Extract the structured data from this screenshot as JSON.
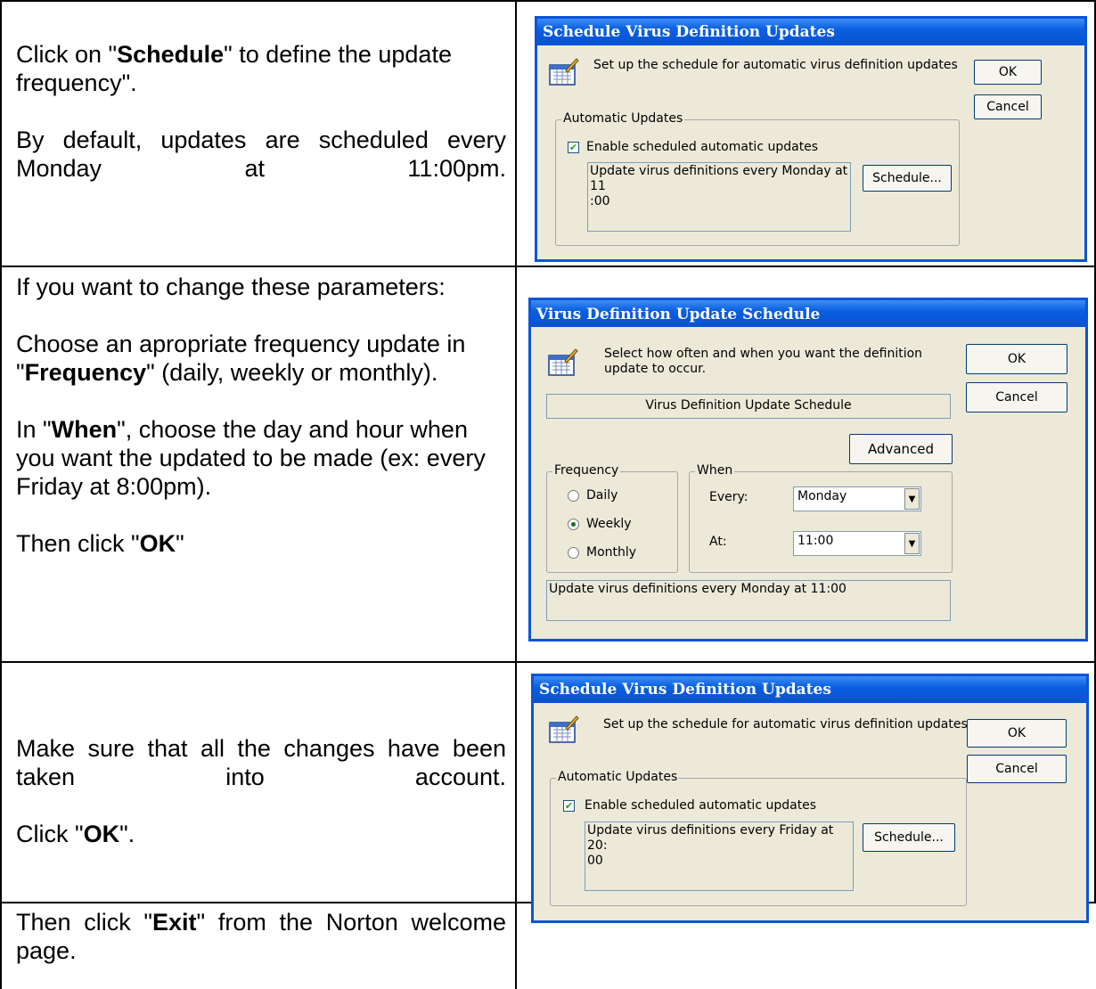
{
  "rows": [
    {
      "left": {
        "p1_a": "Click on \"",
        "p1_bold": "Schedule",
        "p1_b": "\" to define the update frequency\".",
        "p2": "By default, updates are scheduled every Monday at 11:00pm."
      }
    },
    {
      "left": {
        "p1": "If you want to change these parameters:",
        "p2_a": "Choose an apropriate frequency update in \"",
        "p2_bold": "Frequency",
        "p2_b": "\" (daily, weekly or monthly).",
        "p3_a": "In \"",
        "p3_bold": "When",
        "p3_b": "\", choose the day and hour when you want the updated to be made (ex: every Friday at 8:00pm).",
        "p4_a": "Then click \"",
        "p4_bold": "OK",
        "p4_b": "\""
      }
    },
    {
      "left": {
        "p1": "Make sure that all the changes have been taken into account.",
        "p2_a": "Click \"",
        "p2_bold": "OK",
        "p2_b": "\"."
      }
    },
    {
      "left": {
        "p1_a": "Then click \"",
        "p1_bold": "Exit",
        "p1_b": "\" from the Norton welcome page."
      }
    }
  ],
  "dialog1": {
    "title": "Schedule Virus Definition Updates",
    "description": "Set up the schedule for automatic virus definition updates",
    "ok": "OK",
    "cancel": "Cancel",
    "group_label": "Automatic Updates",
    "checkbox_label": "Enable scheduled automatic updates",
    "checked": true,
    "summary_line1": "Update virus definitions every Monday at 11",
    "summary_line2": ":00",
    "schedule_button": "Schedule..."
  },
  "dialog2": {
    "title": "Virus Definition Update Schedule",
    "description_line1": "Select how often and when you want the definition",
    "description_line2": "update to occur.",
    "ok": "OK",
    "cancel": "Cancel",
    "header_box": "Virus Definition Update Schedule",
    "advanced": "Advanced",
    "frequency_label": "Frequency",
    "freq_daily": "Daily",
    "freq_weekly": "Weekly",
    "freq_monthly": "Monthly",
    "selected_frequency": "Weekly",
    "when_label": "When",
    "every_label": "Every:",
    "every_value": "Monday",
    "at_label": "At:",
    "at_value": "11:00",
    "summary": "Update virus definitions every Monday at 11:00"
  },
  "dialog3": {
    "title": "Schedule Virus Definition Updates",
    "description": "Set up the schedule for automatic virus definition updates",
    "ok": "OK",
    "cancel": "Cancel",
    "group_label": "Automatic Updates",
    "checkbox_label": "Enable scheduled automatic updates",
    "checked": true,
    "summary_line1": "Update virus definitions every Friday at 20:",
    "summary_line2": "00",
    "schedule_button": "Schedule..."
  },
  "icons": {
    "calendar": "calendar-pencil-icon",
    "check": "checkmark-icon",
    "dropdown": "chevron-down-icon"
  }
}
